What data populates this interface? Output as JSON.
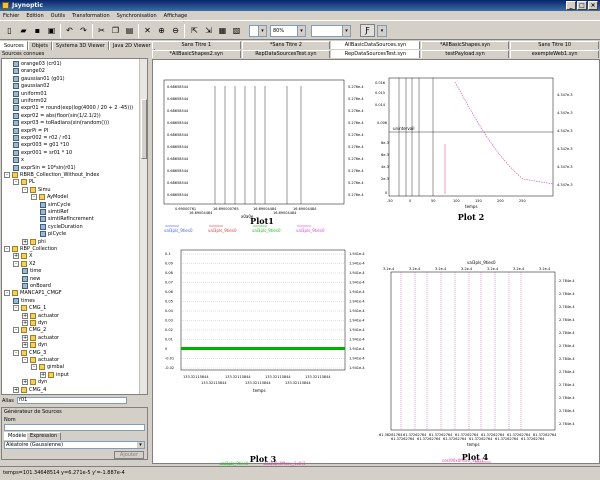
{
  "window": {
    "title": "Jsynoptic"
  },
  "menu": [
    "Fichier",
    "Edition",
    "Outils",
    "Transformation",
    "Synchronisation",
    "Affichage"
  ],
  "toolbar": {
    "zoom_value": "80%",
    "dropdown2_value": ""
  },
  "left_tabs": [
    "Sources",
    "Objets",
    "Systema 3D Viewer",
    "Java 2D Viewer"
  ],
  "sources_label": "Sources connues",
  "tree": [
    {
      "label": "orange03 (cr01)",
      "level": 1,
      "type": "v"
    },
    {
      "label": "orange02",
      "level": 1,
      "type": "v"
    },
    {
      "label": "gaussian01 (g01)",
      "level": 1,
      "type": "v"
    },
    {
      "label": "gaussian02",
      "level": 1,
      "type": "v"
    },
    {
      "label": "uniform01",
      "level": 1,
      "type": "v"
    },
    {
      "label": "uniform02",
      "level": 1,
      "type": "v"
    },
    {
      "label": "expr01 = round(exp(log(4000 / 20 + 2 -45)))",
      "level": 1,
      "type": "v"
    },
    {
      "label": "expr02 = abs(floor(sin(1/2.1/2))",
      "level": 1,
      "type": "v"
    },
    {
      "label": "expr03 = toRadians(sin(random()))",
      "level": 1,
      "type": "v"
    },
    {
      "label": "exprPi = PI",
      "level": 1,
      "type": "v"
    },
    {
      "label": "expr002 = r02 / r01",
      "level": 1,
      "type": "v"
    },
    {
      "label": "expr003 = g01 *10",
      "level": 1,
      "type": "v"
    },
    {
      "label": "expr001 = sr01 * 10",
      "level": 1,
      "type": "v"
    },
    {
      "label": "x",
      "level": 1,
      "type": "v"
    },
    {
      "label": "exprSin = 10*sin(r01)",
      "level": 1,
      "type": "v"
    },
    {
      "label": "RBRB_Collection_Without_Index",
      "level": 0,
      "type": "f",
      "exp": "-"
    },
    {
      "label": "PL",
      "level": 1,
      "type": "f",
      "exp": "-"
    },
    {
      "label": "Simu",
      "level": 2,
      "type": "f",
      "exp": "-"
    },
    {
      "label": "AyModel",
      "level": 3,
      "type": "f",
      "exp": "-"
    },
    {
      "label": "simCycle",
      "level": 4,
      "type": "v"
    },
    {
      "label": "simtiRef",
      "level": 4,
      "type": "v"
    },
    {
      "label": "simtiRefIncrement",
      "level": 4,
      "type": "v"
    },
    {
      "label": "cycleDuration",
      "level": 4,
      "type": "v"
    },
    {
      "label": "piCycle",
      "level": 4,
      "type": "v"
    },
    {
      "label": "phi",
      "level": 2,
      "type": "f",
      "exp": "+"
    },
    {
      "label": "RBP_Collection",
      "level": 0,
      "type": "f",
      "exp": "-"
    },
    {
      "label": "X",
      "level": 1,
      "type": "f",
      "exp": "+"
    },
    {
      "label": "X2",
      "level": 1,
      "type": "f",
      "exp": "-"
    },
    {
      "label": "time",
      "level": 2,
      "type": "v"
    },
    {
      "label": "new",
      "level": 2,
      "type": "v"
    },
    {
      "label": "onBoard",
      "level": 2,
      "type": "v"
    },
    {
      "label": "MANCAP1_CMGF",
      "level": 0,
      "type": "f",
      "exp": "-"
    },
    {
      "label": "times",
      "level": 1,
      "type": "v"
    },
    {
      "label": "CMG_1",
      "level": 1,
      "type": "f",
      "exp": "-"
    },
    {
      "label": "actuator",
      "level": 2,
      "type": "f",
      "exp": "+"
    },
    {
      "label": "dyn",
      "level": 2,
      "type": "f",
      "exp": "+"
    },
    {
      "label": "CMG_2",
      "level": 1,
      "type": "f",
      "exp": "-"
    },
    {
      "label": "actuator",
      "level": 2,
      "type": "f",
      "exp": "+"
    },
    {
      "label": "dyn",
      "level": 2,
      "type": "f",
      "exp": "+"
    },
    {
      "label": "CMG_3",
      "level": 1,
      "type": "f",
      "exp": "-"
    },
    {
      "label": "actuator",
      "level": 2,
      "type": "f",
      "exp": "-"
    },
    {
      "label": "gimbal",
      "level": 3,
      "type": "f",
      "exp": "-"
    },
    {
      "label": "input",
      "level": 4,
      "type": "f",
      "exp": "+"
    },
    {
      "label": "dyn",
      "level": 2,
      "type": "f",
      "exp": "+"
    },
    {
      "label": "CMG_4",
      "level": 1,
      "type": "f",
      "exp": "+"
    }
  ],
  "alias": {
    "label": "Alias",
    "value": "r01"
  },
  "generator": {
    "title": "Générateur de Sources",
    "name_label": "Nom",
    "tabs": [
      "Modèle",
      "Expression"
    ],
    "select_value": "Aléatoire (Gaussienne)",
    "apply_label": "Ajouter"
  },
  "doc_tabs_row1": [
    "Sans Titre 1",
    "*Sans Titre 2",
    "AllBasicDataSources.syn",
    "*AllBasicShapes.syn",
    "Sans Titre 10"
  ],
  "doc_tabs_row2": [
    "*AllBasicShapes2.syn",
    "RepDataSourcesTest.syn",
    "RepDataSourcesTest.syn",
    "testPayload.syn",
    "exempleWeb1.syn"
  ],
  "active_doc_tab": 2,
  "plots": [
    {
      "title": "Plot1",
      "xlabel": "x0a0e",
      "legend": [
        "val3pls_9ties0",
        "val3pls_9ties0",
        "val3pls_9ties0",
        "val3pls_9ties0"
      ]
    },
    {
      "title": "Plot 2",
      "xlabel": "temps",
      "annotation": "unintervail"
    },
    {
      "title": "Plot 3",
      "xlabel": "temps",
      "legend": [
        "val3pls_9ties0",
        "cos(90x0ffsav_1x0)1"
      ]
    },
    {
      "title": "Plot 4",
      "xlabel": "temps",
      "header": "val3pls_9ties0",
      "legend": [
        "cos(90x0ffsav_1x0)1"
      ]
    }
  ],
  "status": "temps=101.34648514   y=6.271e-5   y'=-1.887e-4",
  "colors": {
    "title_bar": "#0a246a",
    "panel": "#d4d0c8",
    "plot_green": "#00b000",
    "plot_pink": "#e040a0"
  }
}
